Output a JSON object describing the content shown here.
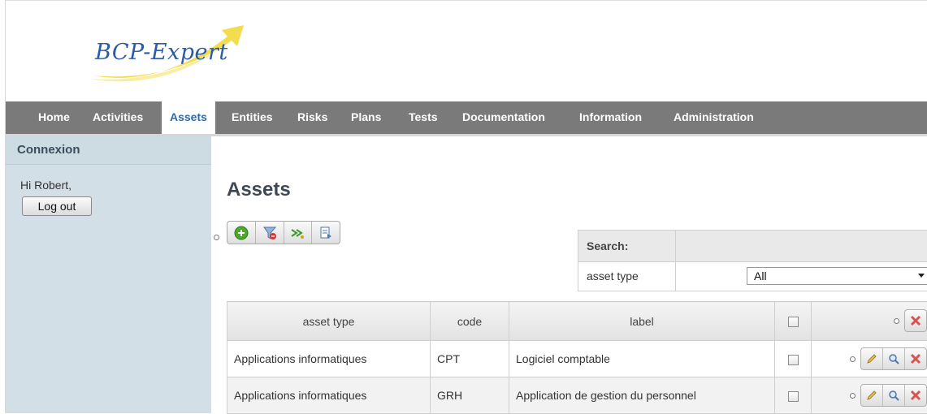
{
  "header": {
    "logo_text": "BCP-Expert"
  },
  "nav": {
    "items": [
      {
        "label": "Home"
      },
      {
        "label": "Activities"
      },
      {
        "label": "Assets"
      },
      {
        "label": "Entities"
      },
      {
        "label": "Risks"
      },
      {
        "label": "Plans"
      },
      {
        "label": "Tests"
      },
      {
        "label": "Documentation"
      },
      {
        "label": "Information"
      },
      {
        "label": "Administration"
      }
    ],
    "active": "Assets"
  },
  "sidebar": {
    "title": "Connexion",
    "greeting": "Hi Robert,",
    "logout_label": "Log out"
  },
  "main": {
    "title": "Assets",
    "toolbar_icons": [
      "add-icon",
      "filter-clear-icon",
      "export-icon",
      "report-icon"
    ],
    "search": {
      "heading": "Search:",
      "field_label": "asset type",
      "field_value": "All"
    },
    "table": {
      "columns": [
        "asset type",
        "code",
        "label"
      ],
      "rows": [
        {
          "asset_type": "Applications informatiques",
          "code": "CPT",
          "label": "Logiciel comptable"
        },
        {
          "asset_type": "Applications informatiques",
          "code": "GRH",
          "label": "Application de gestion du personnel"
        }
      ]
    }
  },
  "colors": {
    "navbar": "#7a7a7a",
    "active_tab_text": "#2c6aa8",
    "sidebar": "#d3dfe6",
    "logo_text": "#2a5aa8",
    "logo_swoosh": "#f2d83a"
  }
}
